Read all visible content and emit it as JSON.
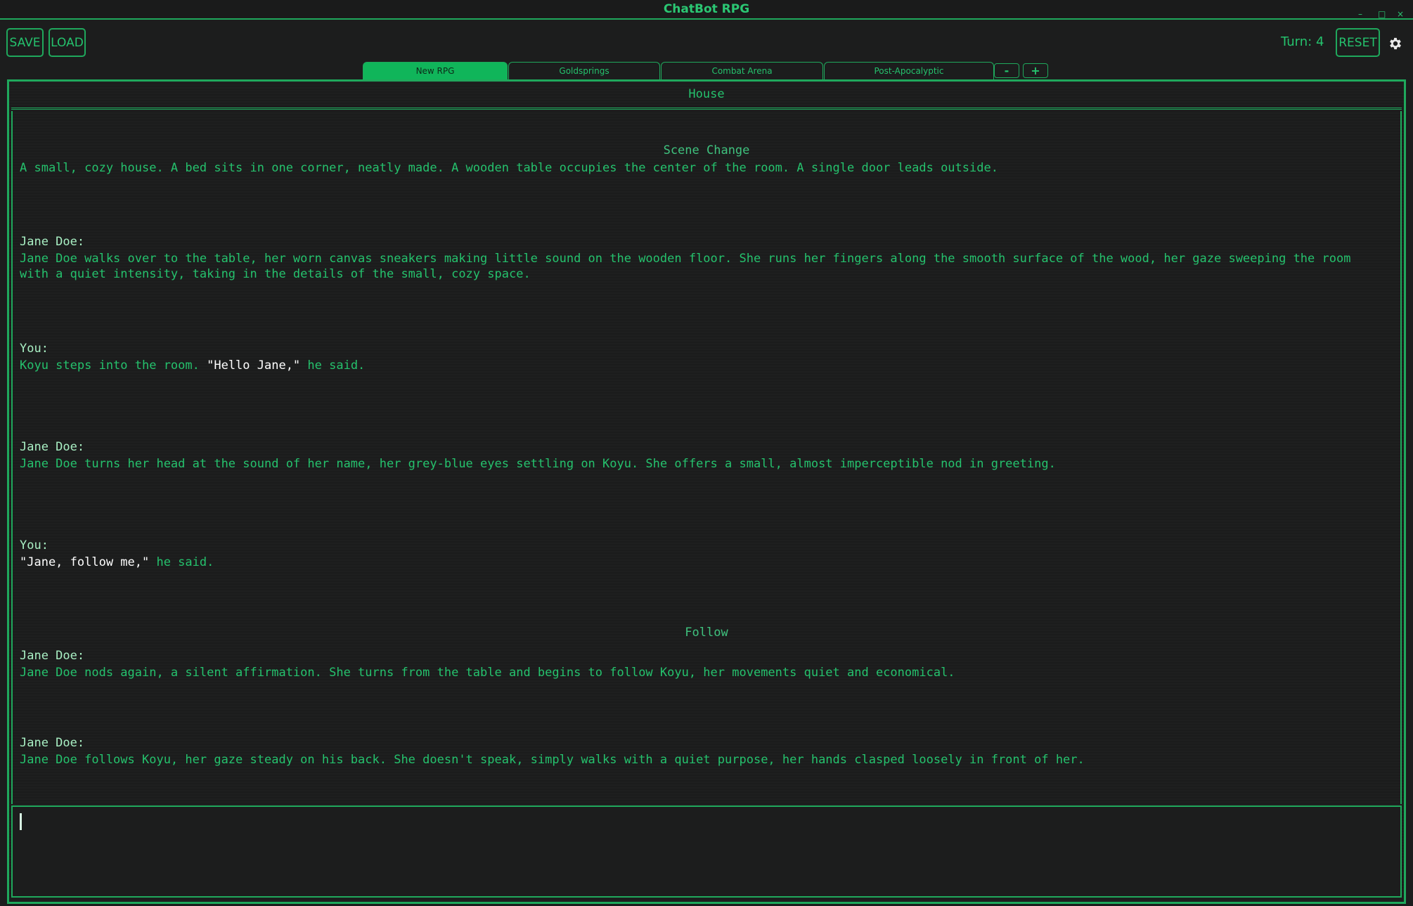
{
  "app": {
    "title": "ChatBot RPG"
  },
  "window_controls": {
    "minimize": "–",
    "maximize": "□",
    "close": "×"
  },
  "toolbar": {
    "save_label": "SAVE",
    "load_label": "LOAD",
    "turn_text": "Turn: 4",
    "reset_label": "RESET",
    "settings_icon": "gear-icon"
  },
  "tabs": [
    {
      "label": "New RPG",
      "active": true
    },
    {
      "label": "Goldsprings",
      "active": false
    },
    {
      "label": "Combat Arena",
      "active": false
    },
    {
      "label": "Post-Apocalyptic",
      "active": false
    }
  ],
  "tab_buttons": {
    "remove_label": "-",
    "add_label": "+"
  },
  "location": "House",
  "log": {
    "scene_change_heading": "Scene Change",
    "scene_change_text": "A small, cozy house. A bed sits in one corner, neatly made. A wooden table occupies the center of the room. A single door leads outside.",
    "msg1_speaker": "Jane Doe:",
    "msg1_text": "Jane Doe walks over to the table, her worn canvas sneakers making little sound on the wooden floor. She runs her fingers along the smooth surface of the wood, her gaze sweeping the room with a quiet intensity, taking in the details of the small, cozy space.",
    "msg2_speaker": "You:",
    "msg2_pre": "Koyu steps into the room. ",
    "msg2_quote": "\"Hello Jane,\"",
    "msg2_post": " he said.",
    "msg3_speaker": "Jane Doe:",
    "msg3_text": "Jane Doe turns her head at the sound of her name, her grey-blue eyes settling on Koyu. She offers a small, almost imperceptible nod in greeting.",
    "msg4_speaker": "You:",
    "msg4_quote": "\"Jane, follow me,\"",
    "msg4_post": " he said.",
    "follow_heading": "Follow",
    "msg5_speaker": "Jane Doe:",
    "msg5_text": "Jane Doe nods again, a silent affirmation. She turns from the table and begins to follow Koyu, her movements quiet and economical.",
    "msg6_speaker": "Jane Doe:",
    "msg6_text": "Jane Doe follows Koyu, her gaze steady on his back. She doesn't speak, simply walks with a quiet purpose, her hands clasped loosely in front of her."
  },
  "input": {
    "value": ""
  },
  "colors": {
    "accent": "#1fa85c",
    "text": "#25c26d",
    "active_tab": "#10b55a",
    "background": "#1c1d1d"
  }
}
